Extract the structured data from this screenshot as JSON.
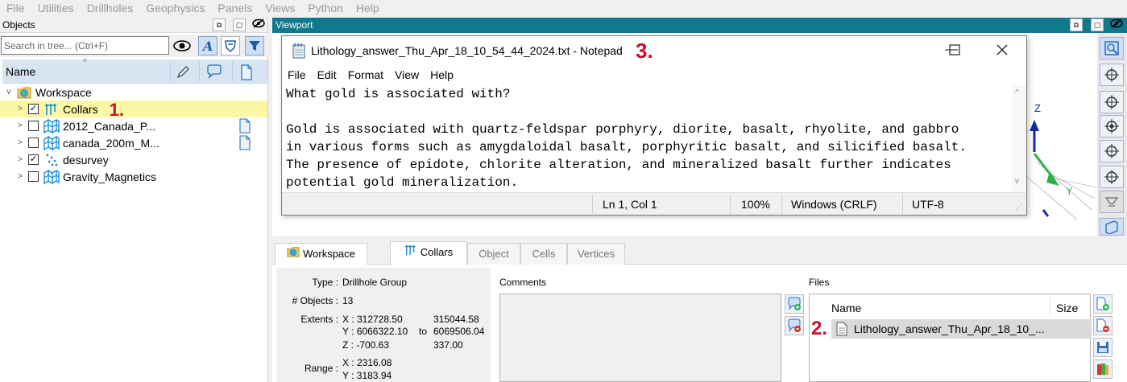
{
  "menubar": [
    "File",
    "Utilities",
    "Drillholes",
    "Geophysics",
    "Panels",
    "Views",
    "Python",
    "Help"
  ],
  "objects_panel": {
    "title": "Objects",
    "search_placeholder": "Search in tree... (Ctrl+F)",
    "header_name": "Name",
    "root": "Workspace",
    "items": [
      {
        "label": "Collars",
        "checked": true,
        "annotation": "1."
      },
      {
        "label": "2012_Canada_P...",
        "checked": false
      },
      {
        "label": "canada_200m_M...",
        "checked": false
      },
      {
        "label": "desurvey",
        "checked": true
      },
      {
        "label": "Gravity_Magnetics",
        "checked": false
      }
    ]
  },
  "viewport": {
    "title": "Viewport",
    "axis_z": "Z",
    "axis_y": "Y"
  },
  "notepad": {
    "title": "Lithology_answer_Thu_Apr_18_10_54_44_2024.txt - Notepad",
    "annotation": "3.",
    "menu": [
      "File",
      "Edit",
      "Format",
      "View",
      "Help"
    ],
    "text": "What gold is associated with?\n\nGold is associated with quartz-feldspar porphyry, diorite, basalt, rhyolite, and gabbro\nin various forms such as amygdaloidal basalt, porphyritic basalt, and silicified basalt.\nThe presence of epidote, chlorite alteration, and mineralized basalt further indicates\npotential gold mineralization.",
    "status": {
      "position": "Ln 1, Col 1",
      "zoom": "100%",
      "line_ending": "Windows (CRLF)",
      "encoding": "UTF-8"
    }
  },
  "bottom": {
    "tabs": [
      "Workspace",
      "Collars",
      "Object",
      "Cells",
      "Vertices"
    ],
    "active_tab": "Collars",
    "props": {
      "type_label": "Type :",
      "type_value": "Drillhole Group",
      "objects_label": "# Objects :",
      "objects_value": "13",
      "extents_label": "Extents :",
      "ext_x": "X : 312728.50",
      "ext_x2": "315044.58",
      "ext_y": "Y : 6066322.10",
      "ext_to": "to",
      "ext_y2": "6069506.04",
      "ext_z": "Z : -700.63",
      "ext_z2": "337.00",
      "range_label": "Range :",
      "range_x": "X : 2316.08",
      "range_y": "Y : 3183.94"
    },
    "comments_label": "Comments",
    "files_label": "Files",
    "files_header_name": "Name",
    "files_header_size": "Size",
    "file_row": "Lithology_answer_Thu_Apr_18_10_...",
    "file_annotation": "2."
  }
}
